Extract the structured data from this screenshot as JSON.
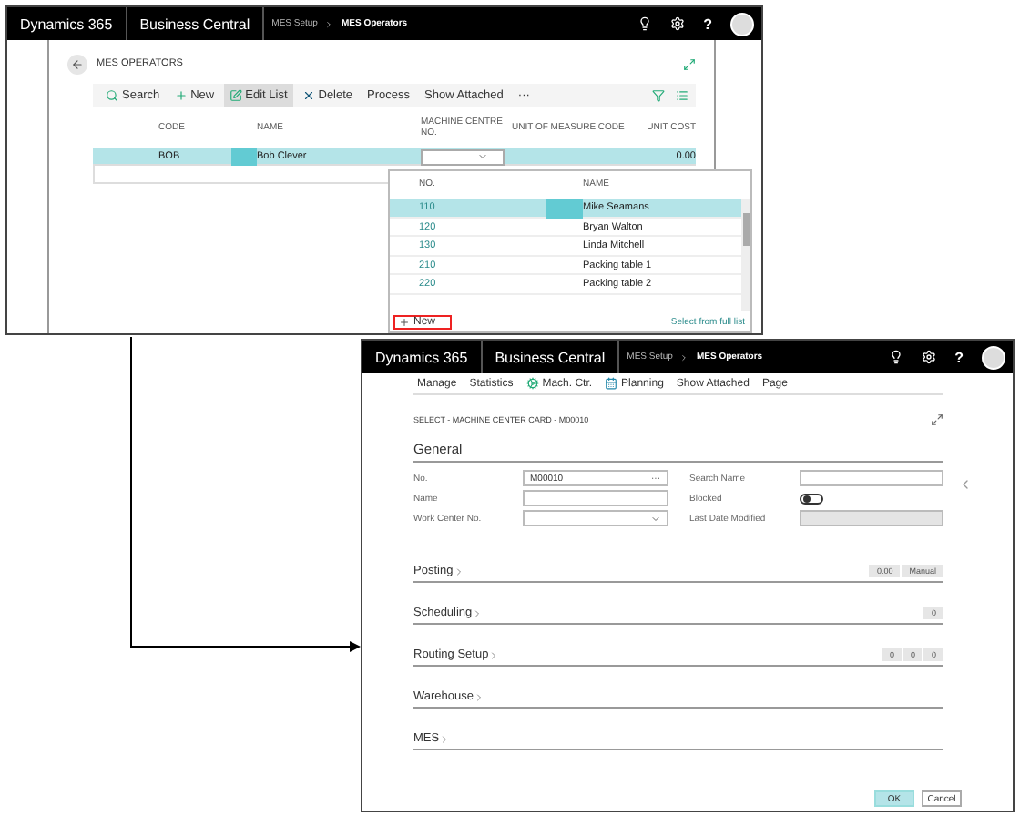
{
  "top_window": {
    "header": {
      "product": "Dynamics 365",
      "app": "Business Central",
      "breadcrumb": [
        {
          "label": "MES Setup",
          "current": false
        },
        {
          "label": "MES Operators",
          "current": true
        }
      ],
      "help": "?"
    },
    "page_title": "MES OPERATORS",
    "actions": [
      {
        "label": "Search",
        "kind": "search",
        "selected": false
      },
      {
        "label": "New",
        "kind": "new",
        "selected": false
      },
      {
        "label": "Edit List",
        "kind": "edit",
        "selected": true
      },
      {
        "label": "Delete",
        "kind": "delete",
        "selected": false
      },
      {
        "label": "Process",
        "kind": "text",
        "selected": false
      },
      {
        "label": "Show Attached",
        "kind": "text",
        "selected": false
      },
      {
        "label": "···",
        "kind": "text",
        "selected": false
      }
    ],
    "table": {
      "columns": [
        "CODE",
        "NAME",
        "MACHINE CENTRE NO.",
        "UNIT OF MEASURE CODE",
        "UNIT COST"
      ],
      "rows": [
        {
          "code": "BOB",
          "name": "Bob Clever",
          "unit_cost": "0.00",
          "selected": true
        }
      ]
    },
    "lookup": {
      "columns": [
        "NO.",
        "NAME"
      ],
      "rows": [
        {
          "no": "110",
          "name": "Mike Seamans",
          "selected": true
        },
        {
          "no": "120",
          "name": "Bryan Walton",
          "selected": false
        },
        {
          "no": "130",
          "name": "Linda Mitchell",
          "selected": false
        },
        {
          "no": "210",
          "name": "Packing table 1",
          "selected": false
        },
        {
          "no": "220",
          "name": "Packing table 2",
          "selected": false
        }
      ],
      "new_label": "New",
      "full_list": "Select from full list"
    }
  },
  "bottom_window": {
    "header": {
      "product": "Dynamics 365",
      "app": "Business Central",
      "breadcrumb": [
        {
          "label": "MES Setup",
          "current": false
        },
        {
          "label": "MES Operators",
          "current": true
        }
      ],
      "help": "?"
    },
    "actions": [
      {
        "label": "Manage",
        "kind": "text"
      },
      {
        "label": "Statistics",
        "kind": "text"
      },
      {
        "label": "Mach. Ctr.",
        "kind": "machine"
      },
      {
        "label": "Planning",
        "kind": "planning"
      },
      {
        "label": "Show Attached",
        "kind": "text"
      },
      {
        "label": "Page",
        "kind": "text"
      }
    ],
    "caption": "SELECT - MACHINE CENTER CARD - M00010",
    "general": {
      "title": "General",
      "fields": [
        {
          "label": "No.",
          "kind": "lookup",
          "value": "M00010",
          "assist": "···"
        },
        {
          "label": "Search Name",
          "kind": "text"
        },
        {
          "label": "Name",
          "kind": "text"
        },
        {
          "label": "Blocked",
          "kind": "toggle",
          "on": false
        },
        {
          "label": "Work Center No.",
          "kind": "dropdown"
        },
        {
          "label": "Last Date Modified",
          "kind": "readonly"
        }
      ]
    },
    "fasttabs": [
      {
        "title": "Posting",
        "badges": [
          "0.00",
          "Manual"
        ]
      },
      {
        "title": "Scheduling",
        "badges": [
          "0"
        ]
      },
      {
        "title": "Routing Setup",
        "badges": [
          "0",
          "0",
          "0"
        ]
      },
      {
        "title": "Warehouse"
      },
      {
        "title": "MES"
      }
    ],
    "buttons": [
      {
        "label": "OK",
        "primary": true
      },
      {
        "label": "Cancel",
        "primary": false
      }
    ]
  }
}
